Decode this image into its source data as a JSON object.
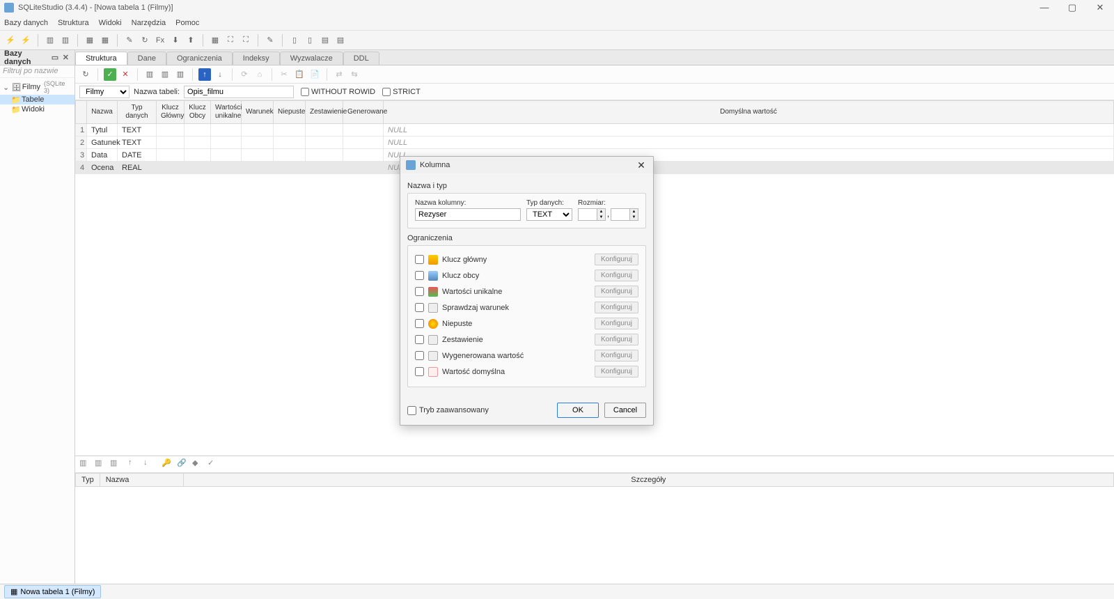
{
  "titlebar": {
    "title": "SQLiteStudio (3.4.4) - [Nowa tabela 1 (Filmy)]"
  },
  "menubar": [
    "Bazy danych",
    "Struktura",
    "Widoki",
    "Narzędzia",
    "Pomoc"
  ],
  "leftpanel": {
    "title": "Bazy danych",
    "filter_placeholder": "Filtruj po nazwie",
    "db_name": "Filmy",
    "db_type": "(SQLite 3)",
    "node_tables": "Tabele",
    "node_views": "Widoki"
  },
  "tabs": [
    "Struktura",
    "Dane",
    "Ograniczenia",
    "Indeksy",
    "Wyzwalacze",
    "DDL"
  ],
  "tablename_row": {
    "db_selected": "Filmy",
    "label": "Nazwa tabeli:",
    "table_name": "Opis_filmu",
    "without_rowid": "WITHOUT ROWID",
    "strict": "STRICT"
  },
  "col_headers": [
    "Nazwa",
    "Typ danych",
    "Klucz Główny",
    "Klucz Obcy",
    "Wartości unikalne",
    "Warunek",
    "Niepuste",
    "Zestawienie",
    "Generowane",
    "Domyślna wartość"
  ],
  "columns": [
    {
      "n": "1",
      "name": "Tytul",
      "type": "TEXT",
      "def": "NULL"
    },
    {
      "n": "2",
      "name": "Gatunek",
      "type": "TEXT",
      "def": "NULL"
    },
    {
      "n": "3",
      "name": "Data",
      "type": "DATE",
      "def": "NULL"
    },
    {
      "n": "4",
      "name": "Ocena",
      "type": "REAL",
      "def": "NULL"
    }
  ],
  "constraints_headers": [
    "Typ",
    "Nazwa",
    "Szczegóły"
  ],
  "bottom_tab": "Nowa tabela 1 (Filmy)",
  "dialog": {
    "title": "Kolumna",
    "group_name": "Nazwa i typ",
    "lbl_colname": "Nazwa kolumny:",
    "val_colname": "Rezyser",
    "lbl_type": "Typ danych:",
    "val_type": "TEXT",
    "lbl_size": "Rozmiar:",
    "size_sep": ",",
    "group_constraints": "Ograniczenia",
    "constraints": [
      {
        "label": "Klucz główny",
        "cfg": "Konfiguruj",
        "icon": "ico-key"
      },
      {
        "label": "Klucz obcy",
        "cfg": "Konfiguruj",
        "icon": "ico-fk"
      },
      {
        "label": "Wartości unikalne",
        "cfg": "Konfiguruj",
        "icon": "ico-uniq"
      },
      {
        "label": "Sprawdzaj warunek",
        "cfg": "Konfiguruj",
        "icon": "ico-chk"
      },
      {
        "label": "Niepuste",
        "cfg": "Konfiguruj",
        "icon": "ico-nn"
      },
      {
        "label": "Zestawienie",
        "cfg": "Konfiguruj",
        "icon": "ico-coll"
      },
      {
        "label": "Wygenerowana wartość",
        "cfg": "Konfiguruj",
        "icon": "ico-gen"
      },
      {
        "label": "Wartość domyślna",
        "cfg": "Konfiguruj",
        "icon": "ico-def"
      }
    ],
    "adv_mode": "Tryb zaawansowany",
    "ok": "OK",
    "cancel": "Cancel"
  }
}
